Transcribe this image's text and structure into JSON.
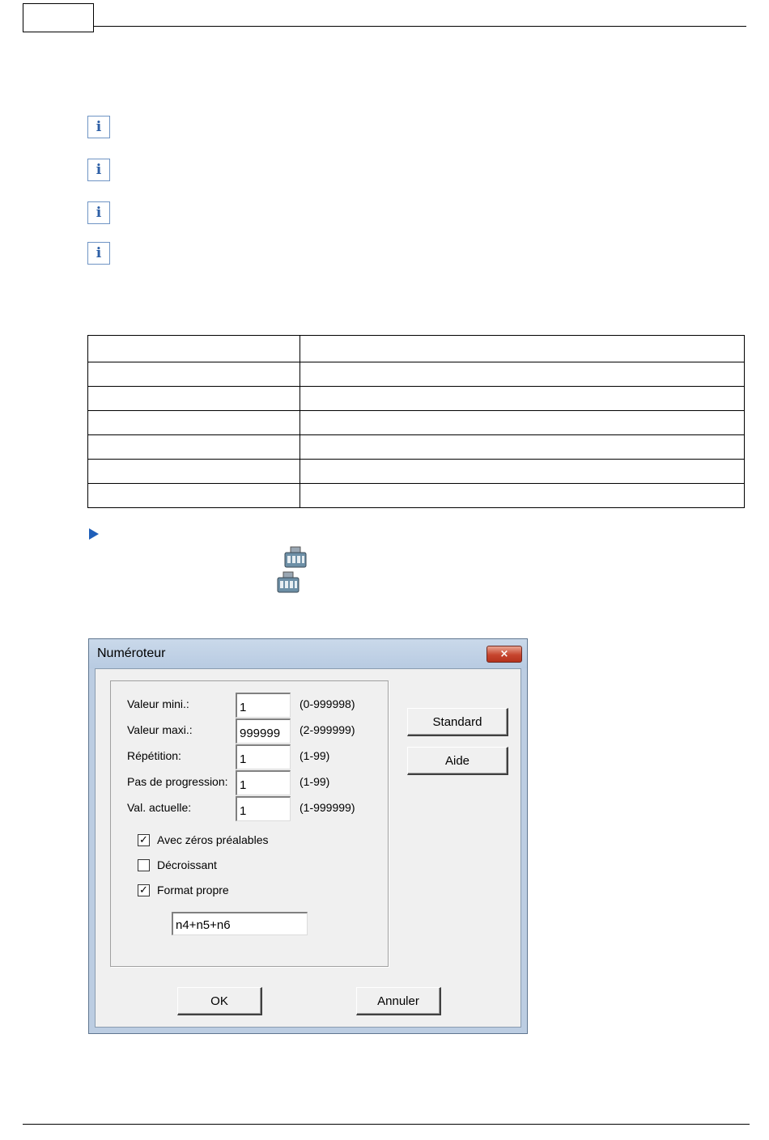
{
  "dialog": {
    "title": "Numéroteur",
    "close_glyph": "×",
    "fields": [
      {
        "label": "Valeur mini.:",
        "value": "1",
        "range": "(0-999998)"
      },
      {
        "label": "Valeur maxi.:",
        "value": "999999",
        "range": "(2-999999)"
      },
      {
        "label": "Répétition:",
        "value": "1",
        "range": "(1-99)"
      },
      {
        "label": "Pas de progression:",
        "value": "1",
        "range": "(1-99)"
      },
      {
        "label": "Val. actuelle:",
        "value": "1",
        "range": "(1-999999)"
      }
    ],
    "checkboxes": [
      {
        "label": "Avec zéros préalables",
        "checked": true
      },
      {
        "label": "Décroissant",
        "checked": false
      },
      {
        "label": "Format propre",
        "checked": true
      }
    ],
    "format_value": "n4+n5+n6",
    "buttons": {
      "standard": "Standard",
      "aide": "Aide",
      "ok": "OK",
      "annuler": "Annuler"
    }
  },
  "icons": {
    "info": "info-icon",
    "arrow": "arrow-right-icon",
    "machine": "numbering-machine-icon",
    "info_glyph": "i",
    "check_glyph": "✓"
  },
  "colors": {
    "info_border": "#6f94c4",
    "arrow": "#1f5fb9",
    "dialog_frame": "#bccde2",
    "close_button": "#c6452e"
  }
}
